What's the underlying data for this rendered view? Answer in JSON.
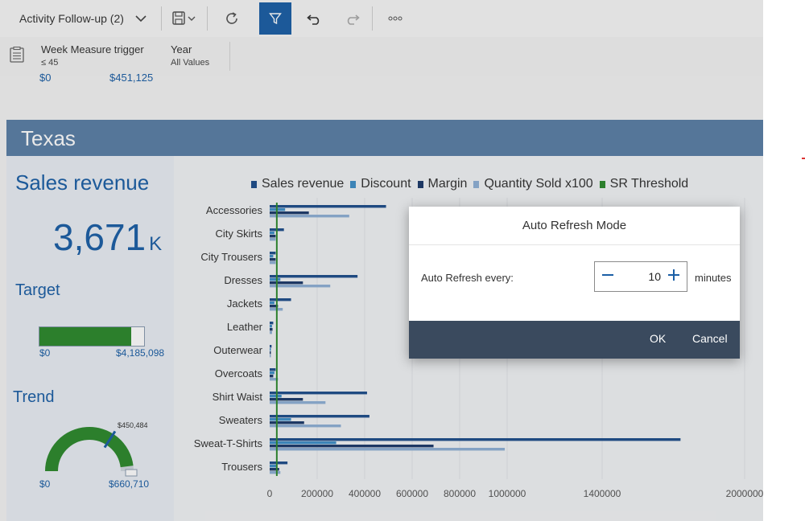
{
  "toolbar": {
    "story_title": "Activity Follow-up (2)"
  },
  "filters": [
    {
      "name": "Week Measure trigger",
      "value": "≤ 45"
    },
    {
      "name": "Year",
      "value": "All Values"
    }
  ],
  "previous_row": {
    "min": "$0",
    "max": "$451,125"
  },
  "section": {
    "title": "Texas",
    "sales_revenue_title": "Sales revenue",
    "kpi_value": "3,671",
    "kpi_unit": "K",
    "target_title": "Target",
    "target_min": "$0",
    "target_max": "$4,185,098",
    "target_progress": 0.877,
    "trend_title": "Trend",
    "trend_min": "$0",
    "trend_max": "$660,710",
    "trend_marker": "$450,484",
    "trend_progress": 0.682
  },
  "colors": {
    "sales_revenue": "#1f4e8c",
    "discount": "#3f8fc8",
    "margin": "#1c3a6b",
    "quantity": "#8fb0d6",
    "threshold": "#2d8a2d",
    "accent": "#1b5fa6"
  },
  "chart_data": {
    "type": "bar",
    "orientation": "horizontal",
    "categories": [
      "Accessories",
      "City Skirts",
      "City Trousers",
      "Dresses",
      "Jackets",
      "Leather",
      "Outerwear",
      "Overcoats",
      "Shirt Waist",
      "Sweaters",
      "Sweat-T-Shirts",
      "Trousers"
    ],
    "series": [
      {
        "name": "Sales revenue",
        "color": "#1f4e8c",
        "values": [
          490000,
          60000,
          25000,
          370000,
          90000,
          15000,
          8000,
          25000,
          410000,
          420000,
          1730000,
          75000
        ]
      },
      {
        "name": "Discount",
        "color": "#3f8fc8",
        "values": [
          65000,
          20000,
          15000,
          45000,
          20000,
          10000,
          5000,
          20000,
          50000,
          90000,
          280000,
          30000
        ]
      },
      {
        "name": "Margin",
        "color": "#1c3a6b",
        "values": [
          165000,
          25000,
          25000,
          140000,
          35000,
          12000,
          5000,
          15000,
          140000,
          145000,
          690000,
          40000
        ]
      },
      {
        "name": "Quantity Sold x100",
        "color": "#8fb0d6",
        "values": [
          335000,
          25000,
          25000,
          255000,
          55000,
          10000,
          5000,
          35000,
          235000,
          300000,
          990000,
          45000
        ]
      }
    ],
    "threshold": {
      "name": "SR Threshold",
      "color": "#2d8a2d",
      "value": 30000
    },
    "x_ticks": [
      0,
      200000,
      400000,
      600000,
      800000,
      1000000,
      1400000,
      2000000
    ],
    "xlim": [
      0,
      2000000
    ],
    "legend": "top",
    "grid": true
  },
  "dialog": {
    "title": "Auto Refresh Mode",
    "label": "Auto Refresh every:",
    "value": "10",
    "unit": "minutes",
    "ok": "OK",
    "cancel": "Cancel"
  }
}
